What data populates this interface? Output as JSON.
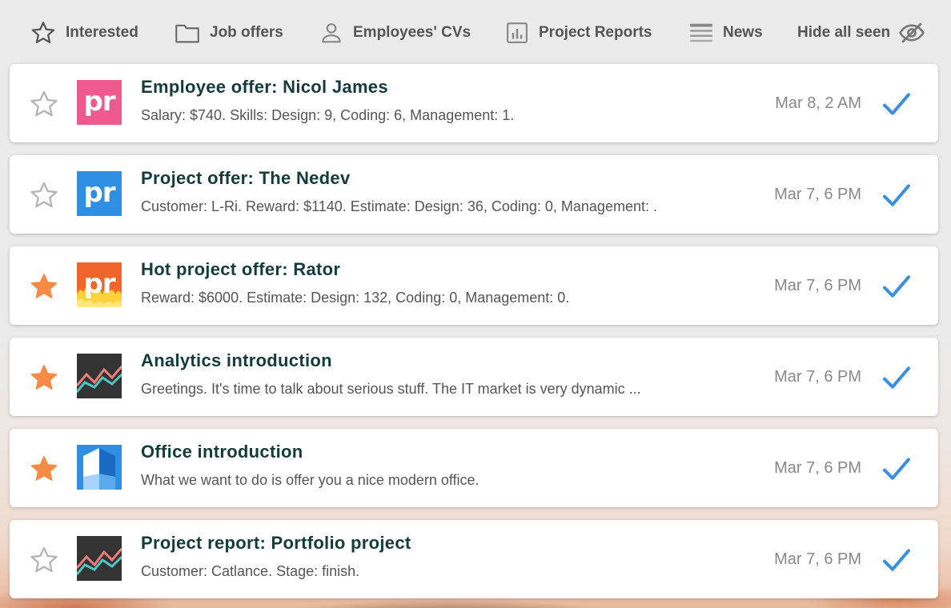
{
  "toolbar": {
    "interested": "Interested",
    "job_offers": "Job offers",
    "employees_cvs": "Employees' CVs",
    "project_reports": "Project Reports",
    "news": "News",
    "hide_all_seen": "Hide all seen"
  },
  "items": [
    {
      "title": "Employee offer: Nicol James",
      "desc": "Salary: $740. Skills: Design: 9, Coding: 6, Management: 1.",
      "date": "Mar 8, 2 AM",
      "starred": false,
      "icon": "pr-pink-icon",
      "icon_text": "pr"
    },
    {
      "title": "Project offer: The Nedev",
      "desc": "Customer: L-Ri. Reward: $1140. Estimate: Design: 36, Coding: 0, Management: .",
      "date": "Mar 7, 6 PM",
      "starred": false,
      "icon": "pr-blue-icon",
      "icon_text": "pr"
    },
    {
      "title": "Hot project offer: Rator",
      "desc": "Reward: $6000. Estimate: Design: 132, Coding: 0, Management: 0.",
      "date": "Mar 7, 6 PM",
      "starred": true,
      "icon": "pr-fire-icon",
      "icon_text": "pr"
    },
    {
      "title": "Analytics introduction",
      "desc": "Greetings. It's time to talk about serious stuff. The IT market is very dynamic ...",
      "date": "Mar 7, 6 PM",
      "starred": true,
      "icon": "analytics-chart-icon"
    },
    {
      "title": "Office introduction",
      "desc": "What we want to do is offer you a nice modern office.",
      "date": "Mar 7, 6 PM",
      "starred": true,
      "icon": "office-building-icon"
    },
    {
      "title": "Project report: Portfolio project",
      "desc": "Customer: Catlance. Stage: finish.",
      "date": "Mar 7, 6 PM",
      "starred": false,
      "icon": "analytics-chart-icon"
    }
  ],
  "colors": {
    "star_active": "#f68b45",
    "star_inactive": "#b5b5b5",
    "check": "#3b8fe0",
    "title": "#153b3b",
    "pr_pink": "#ef5a8e",
    "pr_blue": "#2f8fe3"
  }
}
